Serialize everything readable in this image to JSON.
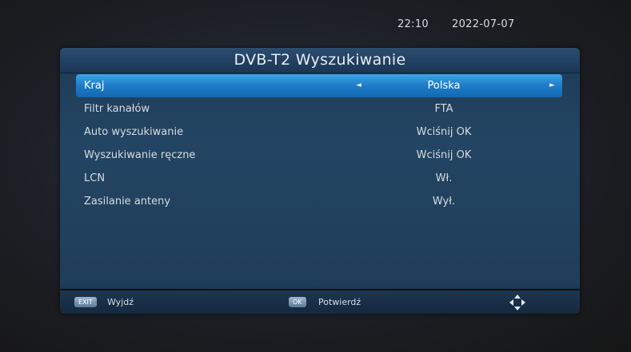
{
  "status_bar": {
    "time": "22:10",
    "date": "2022-07-07"
  },
  "menu": {
    "title": "DVB-T2 Wyszukiwanie",
    "items": [
      {
        "label": "Kraj",
        "value": "Polska",
        "selected": true
      },
      {
        "label": "Filtr kanałów",
        "value": "FTA"
      },
      {
        "label": "Auto wyszukiwanie",
        "value": "Wciśnij OK"
      },
      {
        "label": "Wyszukiwanie ręczne",
        "value": "Wciśnij OK"
      },
      {
        "label": "LCN",
        "value": "Wł."
      },
      {
        "label": "Zasilanie anteny",
        "value": "Wył."
      }
    ],
    "arrow_left": "◄",
    "arrow_right": "►"
  },
  "footer": {
    "exit_key": "EXIT",
    "exit_label": "Wyjdź",
    "ok_key": "OK",
    "ok_label": "Potwierdź",
    "nav_icon": "navigation-arrows-icon"
  },
  "colors": {
    "selection": "#1d7cc8",
    "panel": "#234563",
    "text": "#d6dbe1"
  }
}
